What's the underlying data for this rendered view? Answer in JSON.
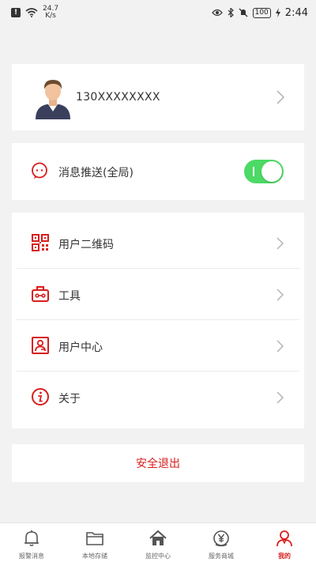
{
  "status_bar": {
    "speed_value": "24.7",
    "speed_unit": "K/s",
    "battery": "100",
    "time": "2:44"
  },
  "profile": {
    "phone": "130XXXXXXXX"
  },
  "push": {
    "label": "消息推送(全局)",
    "enabled": true
  },
  "menu": {
    "items": [
      {
        "label": "用户二维码",
        "icon": "qrcode-icon"
      },
      {
        "label": "工具",
        "icon": "toolbox-icon"
      },
      {
        "label": "用户中心",
        "icon": "user-card-icon"
      },
      {
        "label": "关于",
        "icon": "info-icon"
      }
    ]
  },
  "logout": {
    "label": "安全退出"
  },
  "tabbar": {
    "tabs": [
      {
        "label": "报警消息",
        "icon": "bell-icon"
      },
      {
        "label": "本地存储",
        "icon": "folder-icon"
      },
      {
        "label": "监控中心",
        "icon": "home-icon"
      },
      {
        "label": "服务商城",
        "icon": "shop-icon"
      },
      {
        "label": "我的",
        "icon": "person-icon"
      }
    ],
    "active_index": 4
  },
  "colors": {
    "accent": "#d81e1e",
    "toggle_on": "#4cd964",
    "background": "#f2f2f2"
  }
}
